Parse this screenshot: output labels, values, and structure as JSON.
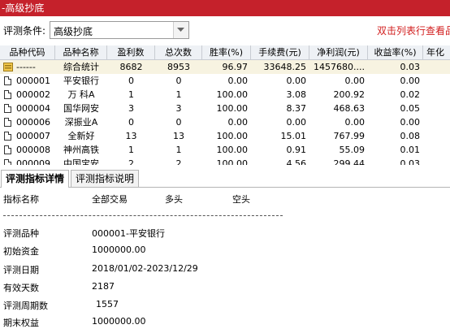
{
  "window": {
    "title": "-高级抄底"
  },
  "criteria": {
    "label": "评测条件:",
    "value": "高级抄底",
    "hint": "双击列表行查看品"
  },
  "table": {
    "headers": [
      "品种代码",
      "品种名称",
      "盈利数",
      "总次数",
      "胜率(%)",
      "手续费(元)",
      "净利润(元)",
      "收益率(%)",
      "年化"
    ],
    "summary": {
      "code": "------",
      "name": "综合统计",
      "wins": "8682",
      "total": "8953",
      "rate": "96.97",
      "fee": "33648.25",
      "profit": "1457680....",
      "yield": "0.03"
    },
    "rows": [
      {
        "code": "000001",
        "name": "平安银行",
        "wins": "0",
        "total": "0",
        "rate": "0.00",
        "fee": "0.00",
        "profit": "0.00",
        "yield": "0.00"
      },
      {
        "code": "000002",
        "name": "万 科A",
        "wins": "1",
        "total": "1",
        "rate": "100.00",
        "fee": "3.08",
        "profit": "200.92",
        "yield": "0.02"
      },
      {
        "code": "000004",
        "name": "国华网安",
        "wins": "3",
        "total": "3",
        "rate": "100.00",
        "fee": "8.37",
        "profit": "468.63",
        "yield": "0.05"
      },
      {
        "code": "000006",
        "name": "深振业A",
        "wins": "0",
        "total": "0",
        "rate": "0.00",
        "fee": "0.00",
        "profit": "0.00",
        "yield": "0.00"
      },
      {
        "code": "000007",
        "name": "全新好",
        "wins": "13",
        "total": "13",
        "rate": "100.00",
        "fee": "15.01",
        "profit": "767.99",
        "yield": "0.08"
      },
      {
        "code": "000008",
        "name": "神州高铁",
        "wins": "1",
        "total": "1",
        "rate": "100.00",
        "fee": "0.91",
        "profit": "55.09",
        "yield": "0.01"
      },
      {
        "code": "000009",
        "name": "中国宝安",
        "wins": "2",
        "total": "2",
        "rate": "100.00",
        "fee": "4.56",
        "profit": "299.44",
        "yield": "0.03"
      }
    ]
  },
  "tabs": [
    {
      "label": "评测指标详情"
    },
    {
      "label": "评测指标说明"
    }
  ],
  "details": {
    "headers": {
      "name": "指标名称",
      "all": "全部交易",
      "long": "多头",
      "short": "空头"
    },
    "items": [
      {
        "label": "评测品种",
        "value": "000001-平安银行"
      },
      {
        "label": "初始资金",
        "value": "1000000.00"
      },
      {
        "label": "评测日期",
        "value": "2018/01/02-2023/12/29"
      },
      {
        "label": "有效天数",
        "value": "2187"
      },
      {
        "label": "评测周期数",
        "value": "1557"
      },
      {
        "label": "期末权益",
        "value": "1000000.00"
      }
    ]
  },
  "colors": {
    "titlebar": "#c5212b",
    "hint": "#d21f1f",
    "summary_row": "#f7f3e1"
  }
}
